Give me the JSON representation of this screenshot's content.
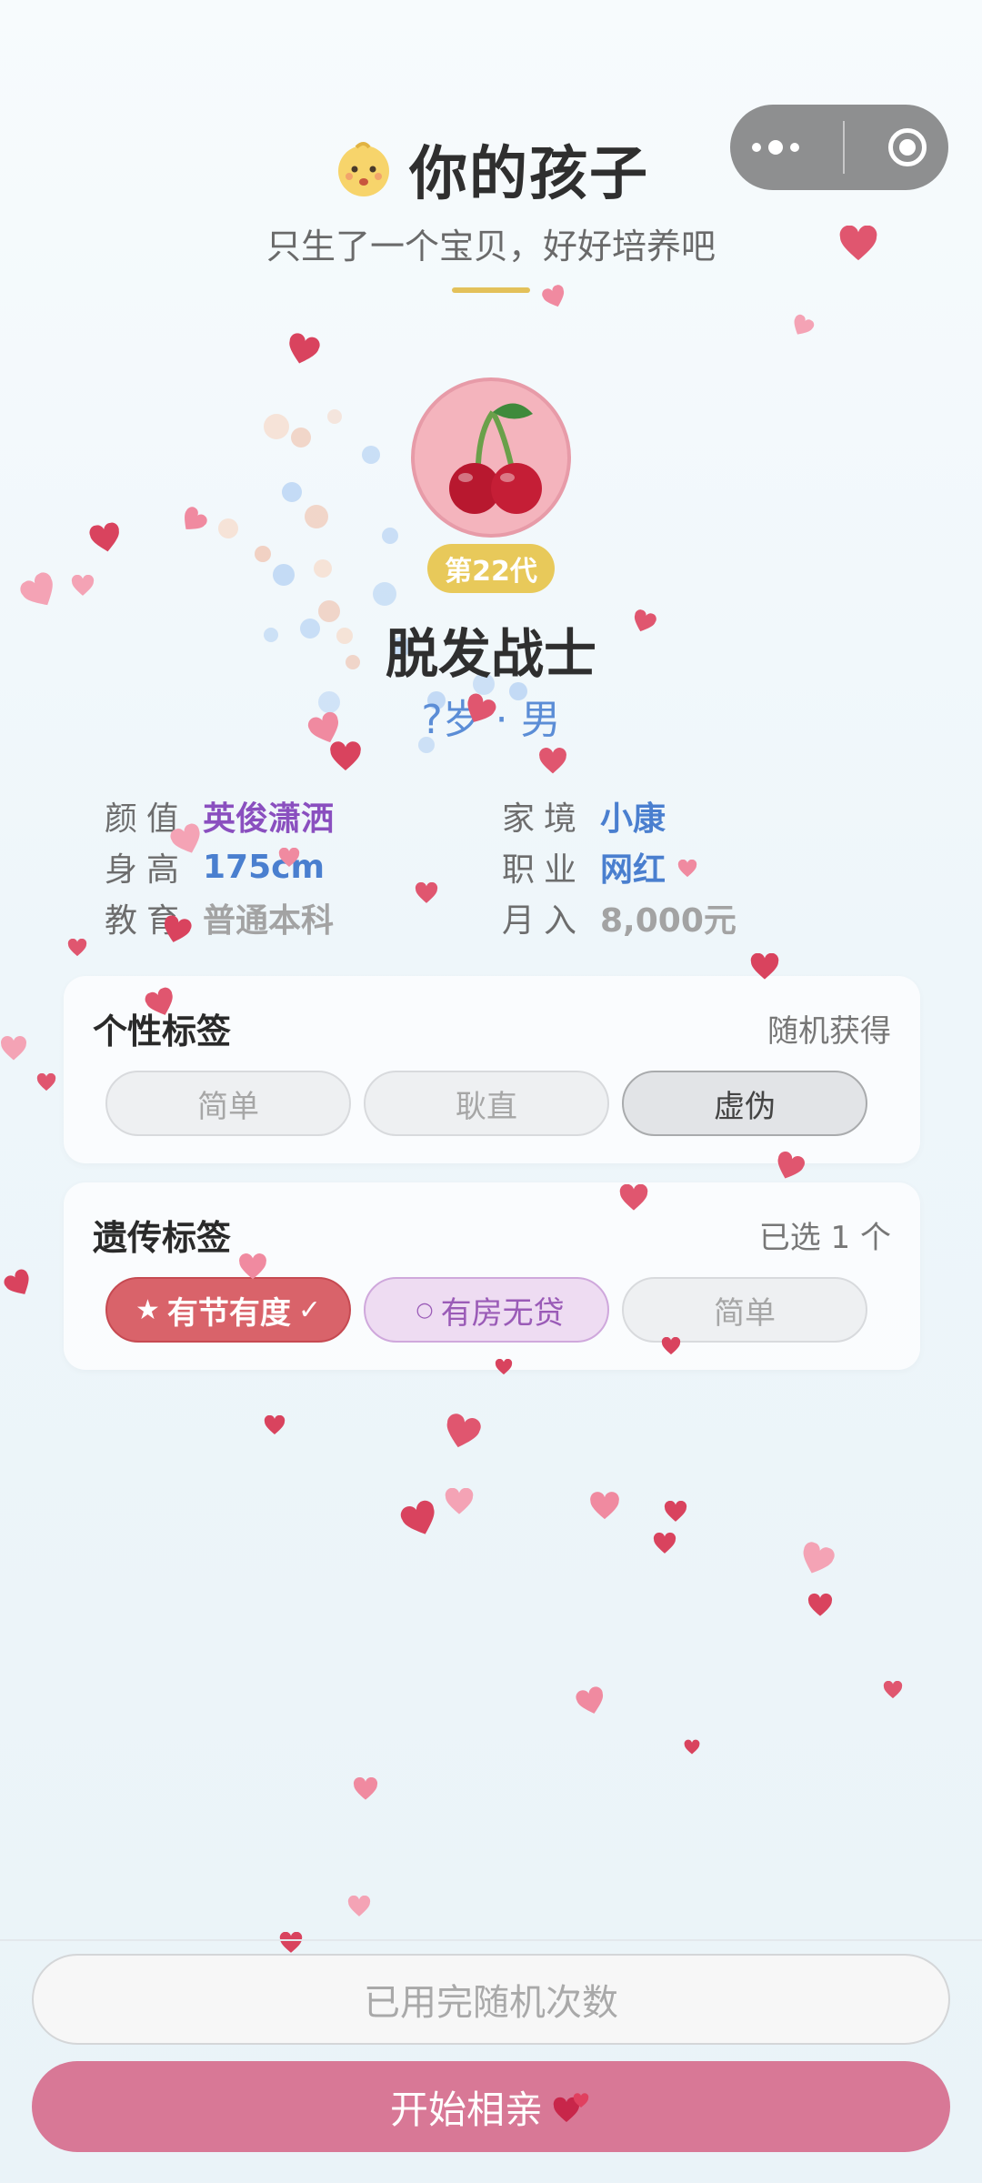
{
  "header": {
    "title": "你的孩子",
    "subtitle": "只生了一个宝贝，好好培养吧"
  },
  "child": {
    "generation": "第22代",
    "name": "脱发战士",
    "age_gender": "?岁 · 男"
  },
  "stats": {
    "appearance": {
      "label": "颜值",
      "value": "英俊潇洒"
    },
    "family": {
      "label": "家境",
      "value": "小康"
    },
    "height": {
      "label": "身高",
      "value": "175cm"
    },
    "job": {
      "label": "职业",
      "value": "网红"
    },
    "education": {
      "label": "教育",
      "value": "普通本科"
    },
    "income": {
      "label": "月入",
      "value": "8,000元"
    }
  },
  "personality": {
    "title": "个性标签",
    "note": "随机获得",
    "tags": [
      "简单",
      "耿直",
      "虚伪"
    ]
  },
  "genetic": {
    "title": "遗传标签",
    "note": "已选 1 个",
    "tags": [
      "有节有度",
      "有房无贷",
      "简单"
    ]
  },
  "buttons": {
    "random_exhausted": "已用完随机次数",
    "start": "开始相亲"
  },
  "colors": {
    "accent_pink": "#d87896",
    "purple_value": "#8a4fbf",
    "blue_value": "#4a7fcf",
    "gray_value": "#a3a3a3",
    "selected_red": "#d9636a"
  },
  "icons": {
    "baby": "baby-face-icon",
    "avatar": "cherry-icon",
    "star": "star-icon",
    "check": "check-icon",
    "heart": "heart-icon"
  }
}
